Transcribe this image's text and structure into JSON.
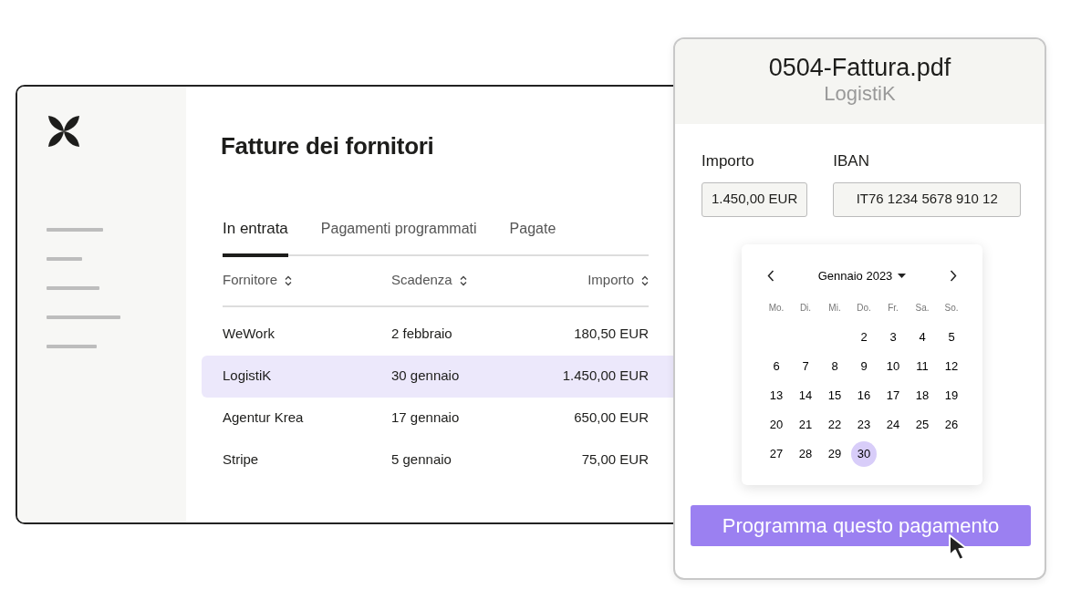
{
  "app": {
    "title": "Fatture dei fornitori",
    "tabs": [
      {
        "label": "In entrata",
        "selected": true
      },
      {
        "label": "Pagamenti programmati",
        "selected": false
      },
      {
        "label": "Pagate",
        "selected": false
      }
    ],
    "table": {
      "columns": [
        "Fornitore",
        "Scadenza",
        "Importo"
      ],
      "rows": [
        {
          "cells": [
            "WeWork",
            "2 febbraio",
            "180,50 EUR"
          ],
          "selected": false
        },
        {
          "cells": [
            "LogistiK",
            "30 gennaio",
            "1.450,00 EUR"
          ],
          "selected": true
        },
        {
          "cells": [
            "Agentur Krea",
            "17 gennaio",
            "650,00 EUR"
          ],
          "selected": false
        },
        {
          "cells": [
            "Stripe",
            "5 gennaio",
            "75,00 EUR"
          ],
          "selected": false
        }
      ]
    }
  },
  "dialog": {
    "title": "0504-Fattura.pdf",
    "subtitle": "LogistiK",
    "fields": [
      {
        "label": "Importo",
        "value": "1.450,00 EUR"
      },
      {
        "label": "IBAN",
        "value": "IT76 1234 5678 910 12"
      }
    ],
    "calendar": {
      "month": "Gennaio 2023",
      "weekdays": [
        "Mo.",
        "Di.",
        "Mi.",
        "Do.",
        "Fr.",
        "Sa.",
        "So."
      ],
      "weeks": [
        {
          "right_aligned": true,
          "days": [
            {
              "day": "2",
              "selected": false
            },
            {
              "day": "3",
              "selected": false
            },
            {
              "day": "4",
              "selected": false
            },
            {
              "day": "5",
              "selected": false
            }
          ]
        },
        {
          "days": [
            {
              "day": "6",
              "selected": false
            },
            {
              "day": "7",
              "selected": false
            },
            {
              "day": "8",
              "selected": false
            },
            {
              "day": "9",
              "selected": false
            },
            {
              "day": "10",
              "selected": false
            },
            {
              "day": "11",
              "selected": false
            },
            {
              "day": "12",
              "selected": false
            }
          ]
        },
        {
          "days": [
            {
              "day": "13",
              "selected": false
            },
            {
              "day": "14",
              "selected": false
            },
            {
              "day": "15",
              "selected": false
            },
            {
              "day": "16",
              "selected": false
            },
            {
              "day": "17",
              "selected": false
            },
            {
              "day": "18",
              "selected": false
            },
            {
              "day": "19",
              "selected": false
            }
          ]
        },
        {
          "days": [
            {
              "day": "20",
              "selected": false
            },
            {
              "day": "21",
              "selected": false
            },
            {
              "day": "22",
              "selected": false
            },
            {
              "day": "23",
              "selected": false
            },
            {
              "day": "24",
              "selected": false
            },
            {
              "day": "25",
              "selected": false
            },
            {
              "day": "26",
              "selected": false
            }
          ]
        },
        {
          "right_aligned": false,
          "days": [
            {
              "day": "27",
              "selected": false
            },
            {
              "day": "28",
              "selected": false
            },
            {
              "day": "29",
              "selected": false
            },
            {
              "day": "30",
              "selected": true
            }
          ]
        }
      ]
    },
    "button": "Programma questo pagamento"
  }
}
